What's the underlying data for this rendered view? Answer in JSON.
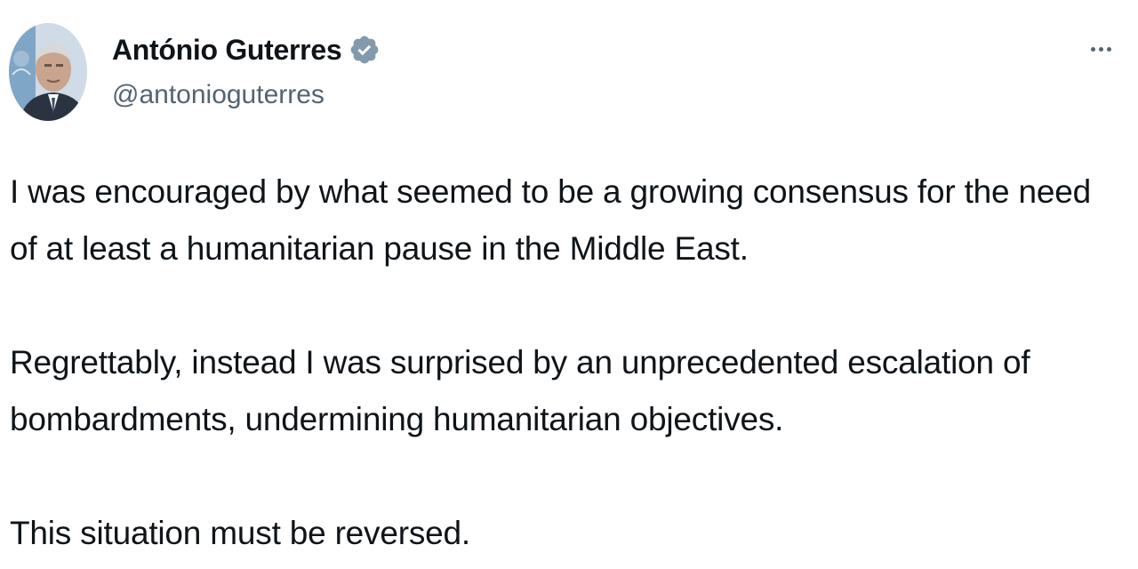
{
  "tweet": {
    "author": {
      "display_name": "António Guterres",
      "handle": "@antonioguterres",
      "verified": true,
      "avatar_icon": "profile-photo",
      "verified_icon": "verified-badge-icon",
      "verified_color": "#829aab"
    },
    "menu_icon": "more-options-icon",
    "paragraphs": [
      {
        "lines": [
          "I was encouraged by what seemed to be a growing consensus for the need",
          "of at least a humanitarian pause in the Middle East."
        ]
      },
      {
        "lines": [
          "Regrettably, instead I was surprised by an unprecedented escalation of",
          "bombardments, undermining humanitarian objectives."
        ]
      },
      {
        "lines": [
          "This situation must be reversed."
        ]
      }
    ]
  },
  "colors": {
    "text_primary": "#0f1419",
    "text_secondary": "#536471",
    "background": "#ffffff"
  }
}
